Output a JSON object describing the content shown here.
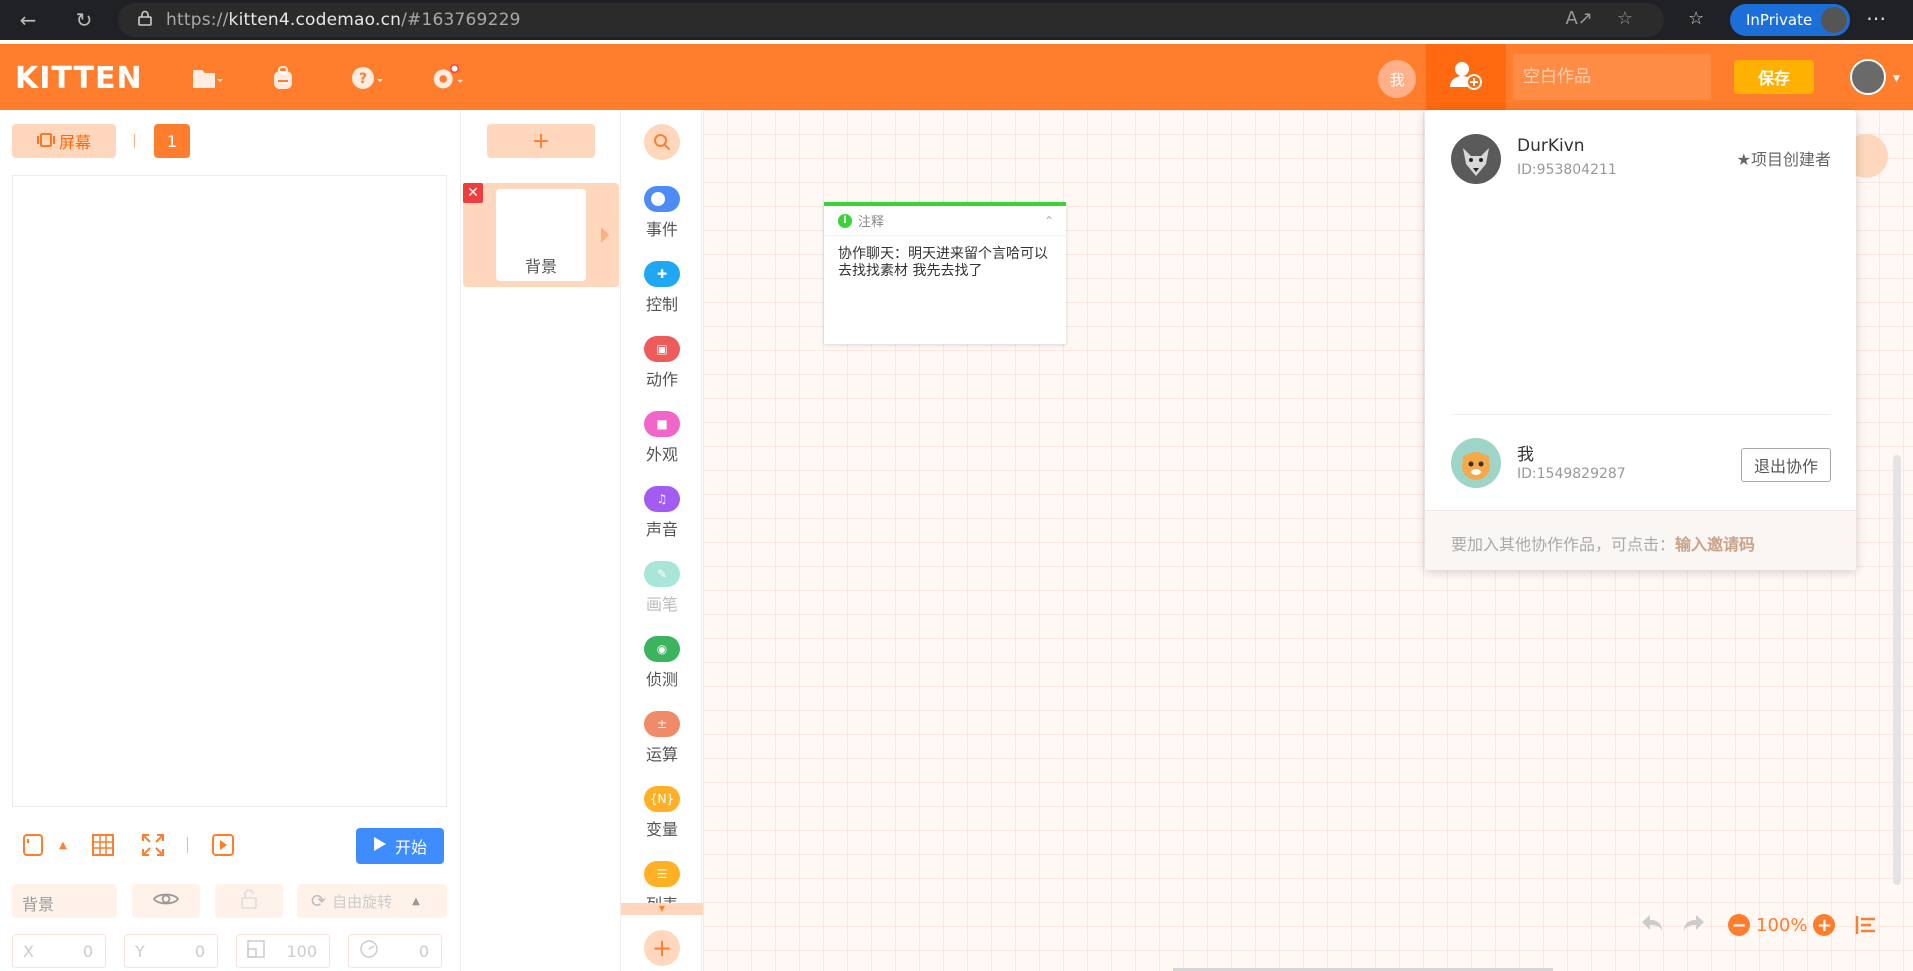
{
  "browser": {
    "url_prefix": "https://",
    "url_domain": "kitten4.codemao.cn",
    "url_path": "/#163769229",
    "inprivate_label": "InPrivate"
  },
  "header": {
    "logo": "KITTEN",
    "me_label": "我",
    "title_placeholder": "空白作品",
    "save_label": "保存",
    "accent": "#ff7e2e"
  },
  "stage": {
    "screen_label": "屏幕",
    "screen_number": "1",
    "start_label": "开始",
    "sprite_name": "背景",
    "rotate_label": "自由旋转",
    "x_label": "X",
    "x_value": "0",
    "y_label": "Y",
    "y_value": "0",
    "scale_value": "100",
    "angle_value": "0"
  },
  "sprites": {
    "add_label": "+",
    "items": [
      {
        "label": "背景"
      }
    ]
  },
  "categories": [
    {
      "label": "事件",
      "color": "#4d8bf7",
      "icon": "event-icon"
    },
    {
      "label": "控制",
      "color": "#1fa7f3",
      "icon": "control-icon"
    },
    {
      "label": "动作",
      "color": "#ee5b5b",
      "icon": "motion-icon"
    },
    {
      "label": "外观",
      "color": "#f067c9",
      "icon": "looks-icon"
    },
    {
      "label": "声音",
      "color": "#a35cf2",
      "icon": "sound-icon"
    },
    {
      "label": "画笔",
      "color": "#a8e6d8",
      "icon": "pen-icon"
    },
    {
      "label": "侦测",
      "color": "#3cb35e",
      "icon": "sensing-icon"
    },
    {
      "label": "运算",
      "color": "#f08b6a",
      "icon": "operator-icon"
    },
    {
      "label": "变量",
      "color": "#ffb024",
      "icon": "variable-icon"
    },
    {
      "label": "列表",
      "color": "#ffb024",
      "icon": "list-icon"
    }
  ],
  "note": {
    "title": "注释",
    "body": "协作聊天：明天进来留个言哈可以去找找素材 我先去找了"
  },
  "zoom": {
    "value": "100%"
  },
  "collab": {
    "members": [
      {
        "name": "DurKivn",
        "id": "ID:953804211",
        "tag": "★项目创建者"
      },
      {
        "name": "我",
        "id": "ID:1549829287",
        "action": "退出协作"
      }
    ],
    "footer_text": "要加入其他协作作品，可点击：",
    "footer_link": "输入邀请码"
  }
}
